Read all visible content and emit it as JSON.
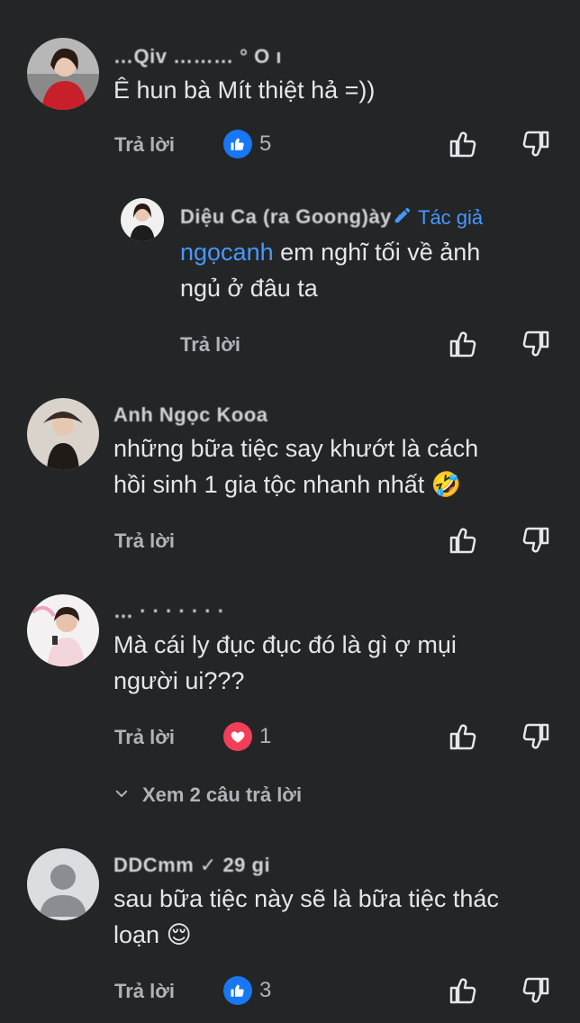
{
  "comments": [
    {
      "author": "…Qiv ……… ° O ı",
      "text_lines": [
        "Ê hun bà Mít thiệt hả =))"
      ],
      "reply_label": "Trả lời",
      "reaction": {
        "type": "like",
        "count": "5"
      },
      "reply": {
        "author": "Diệu Ca (ra Goong)ày ·",
        "author_badge": "Tác giả",
        "mention": "ngọcanh",
        "text_after_mention": " em nghĩ tối về ảnh",
        "text_line2": "ngủ ở đâu ta",
        "reply_label": "Trả lời"
      }
    },
    {
      "author": "Anh Ngọc Kooa",
      "text_lines": [
        "những bữa tiệc say khướt là cách",
        "hồi sinh 1 gia tộc nhanh nhất"
      ],
      "emoji": "🤣",
      "reply_label": "Trả lời"
    },
    {
      "author": "…  ·  ·  ·  ·  ·  ·  ·",
      "text_lines": [
        "Mà cái ly đục đục đó là gì ợ mụi",
        "người ui???"
      ],
      "reply_label": "Trả lời",
      "reaction": {
        "type": "love",
        "count": "1"
      },
      "view_replies": "Xem 2 câu trả lời"
    },
    {
      "author": "DDCmm ✓ 29 gi",
      "text_lines": [
        "sau bữa tiệc này sẽ là bữa tiệc thác",
        "loạn"
      ],
      "emoji": "😌",
      "reply_label": "Trả lời",
      "reaction": {
        "type": "like",
        "count": "3"
      }
    }
  ],
  "colors": {
    "background": "#242526",
    "text": "#e4e6eb",
    "muted": "#b0b3b8",
    "link": "#4599ff",
    "like": "#1877f2",
    "love": "#f33e58"
  }
}
